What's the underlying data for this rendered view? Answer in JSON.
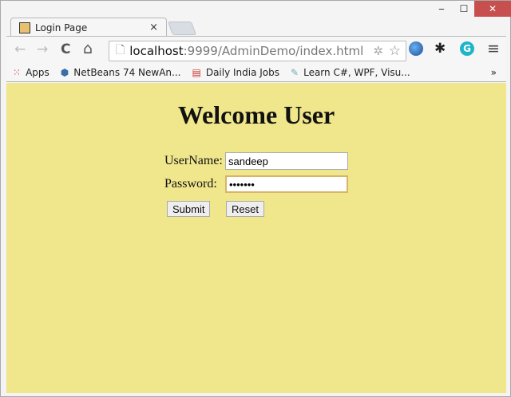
{
  "window": {
    "minimize": "‒",
    "maximize": "☐",
    "close": "✕"
  },
  "tab": {
    "title": "Login Page",
    "close": "×"
  },
  "toolbar": {
    "back": "←",
    "forward": "→",
    "reload": "C",
    "home": "⌂",
    "url_host": "localhost",
    "url_rest": ":9999/AdminDemo/index.html",
    "menu": "≡"
  },
  "bookmarks": [
    {
      "label": "Apps",
      "icon": "apps-grid-icon"
    },
    {
      "label": "NetBeans 74 NewAn...",
      "icon": "netbeans-cube-icon"
    },
    {
      "label": "Daily India Jobs",
      "icon": "jobs-site-icon"
    },
    {
      "label": "Learn C#, WPF, Visu...",
      "icon": "learn-site-icon"
    }
  ],
  "bookmarks_more": "»",
  "page": {
    "heading": "Welcome User",
    "username_label": "UserName:",
    "username_value": "sandeep",
    "password_label": "Password:",
    "password_masked": "•••••••",
    "submit": "Submit",
    "reset": "Reset"
  },
  "colors": {
    "background": "#F0E68C",
    "close_button": "#C7504E"
  }
}
